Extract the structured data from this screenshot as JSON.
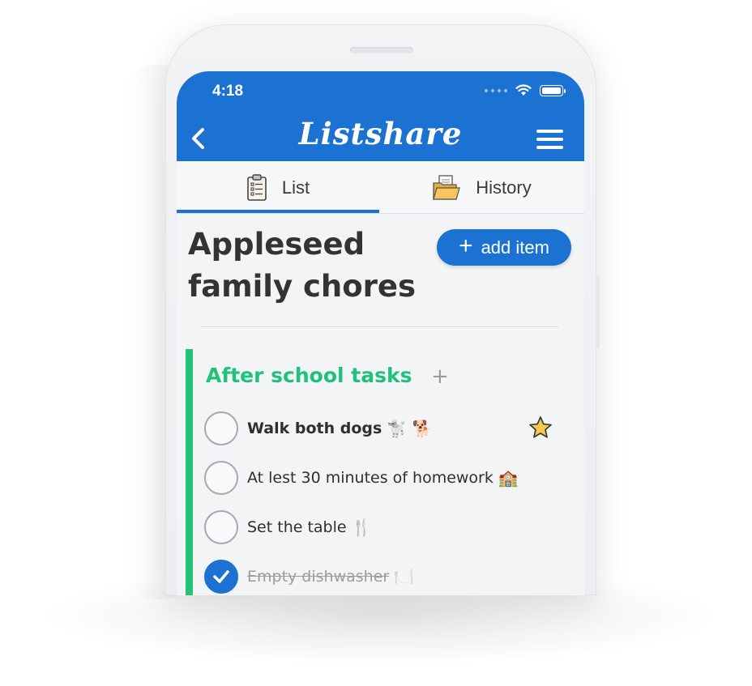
{
  "status_bar": {
    "time": "4:18"
  },
  "header": {
    "brand": "Listshare"
  },
  "tabs": [
    {
      "label": "List",
      "icon": "clipboard-icon"
    },
    {
      "label": "History",
      "icon": "folder-icon"
    }
  ],
  "list": {
    "title": "Appleseed family chores",
    "add_item_label": "add item",
    "sections": [
      {
        "title": "After school tasks",
        "add_symbol": "+",
        "items": [
          {
            "text": "Walk both dogs",
            "emoji": "🐩 🐕",
            "starred": true,
            "checked": false
          },
          {
            "text": "At lest 30 minutes of homework",
            "emoji": "🏫",
            "starred": false,
            "checked": false
          },
          {
            "text": "Set the table",
            "emoji": "🍴",
            "starred": false,
            "checked": false
          },
          {
            "text": "Empty dishwasher",
            "emoji": "🍽️",
            "starred": false,
            "checked": true
          }
        ]
      }
    ]
  },
  "colors": {
    "primary": "#1b72d3",
    "section_accent": "#1ec27a",
    "star": "#f2c94c"
  }
}
